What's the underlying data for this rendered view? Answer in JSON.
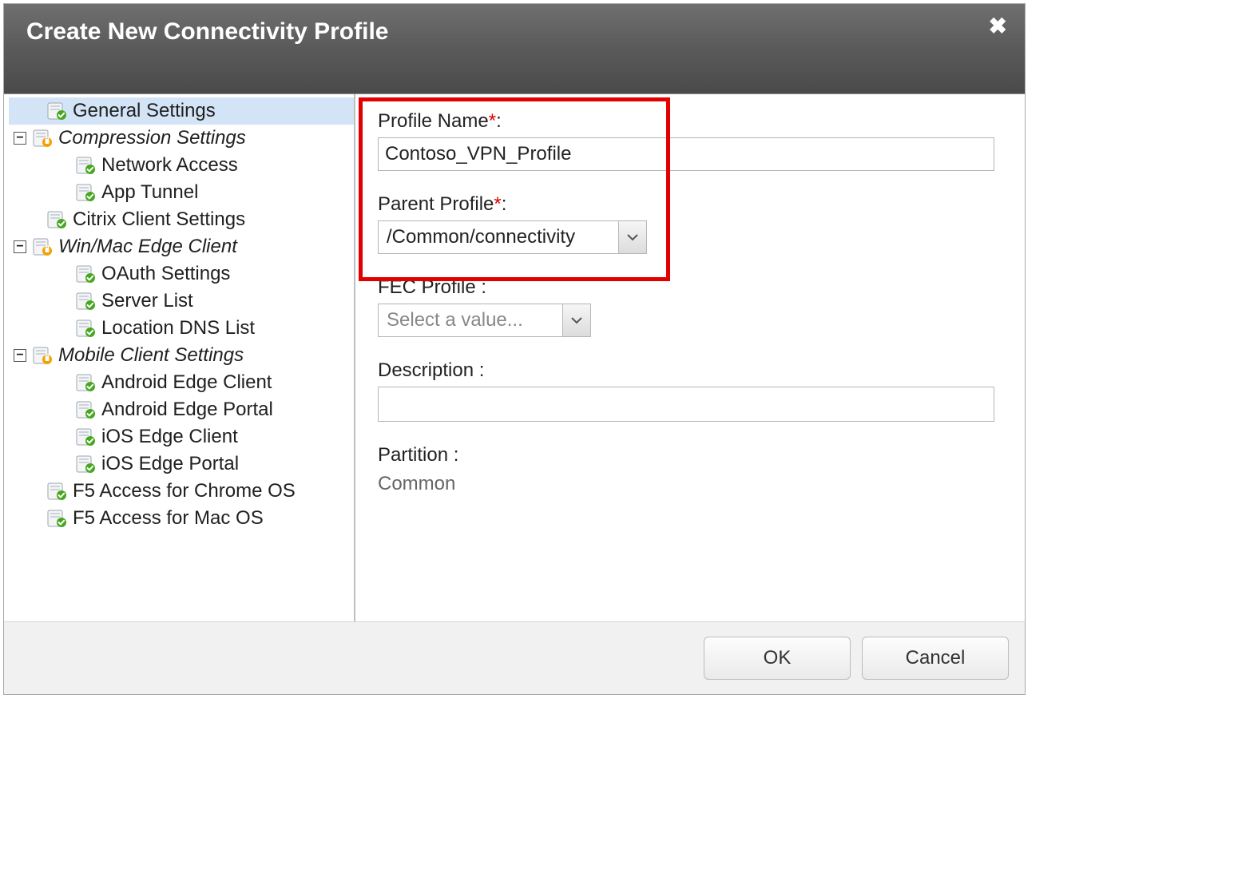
{
  "dialog": {
    "title": "Create New Connectivity Profile"
  },
  "tree": {
    "general": "General Settings",
    "compression": {
      "label": "Compression Settings",
      "network_access": "Network Access",
      "app_tunnel": "App Tunnel"
    },
    "citrix": "Citrix Client Settings",
    "edge": {
      "label": "Win/Mac Edge Client",
      "oauth": "OAuth Settings",
      "server_list": "Server List",
      "location_dns": "Location DNS List"
    },
    "mobile": {
      "label": "Mobile Client Settings",
      "android_client": "Android Edge Client",
      "android_portal": "Android Edge Portal",
      "ios_client": "iOS Edge Client",
      "ios_portal": "iOS Edge Portal"
    },
    "chrome": "F5 Access for Chrome OS",
    "mac": "F5 Access for Mac OS"
  },
  "form": {
    "profile_name": {
      "label": "Profile Name",
      "value": "Contoso_VPN_Profile"
    },
    "parent_profile": {
      "label": "Parent Profile",
      "value": "/Common/connectivity"
    },
    "fec_profile": {
      "label": "FEC Profile",
      "placeholder": "Select a value..."
    },
    "description": {
      "label": "Description",
      "value": ""
    },
    "partition": {
      "label": "Partition",
      "value": "Common"
    }
  },
  "buttons": {
    "ok": "OK",
    "cancel": "Cancel"
  },
  "glyphs": {
    "colon": " :",
    "colon_req": ":",
    "minus": "−"
  }
}
